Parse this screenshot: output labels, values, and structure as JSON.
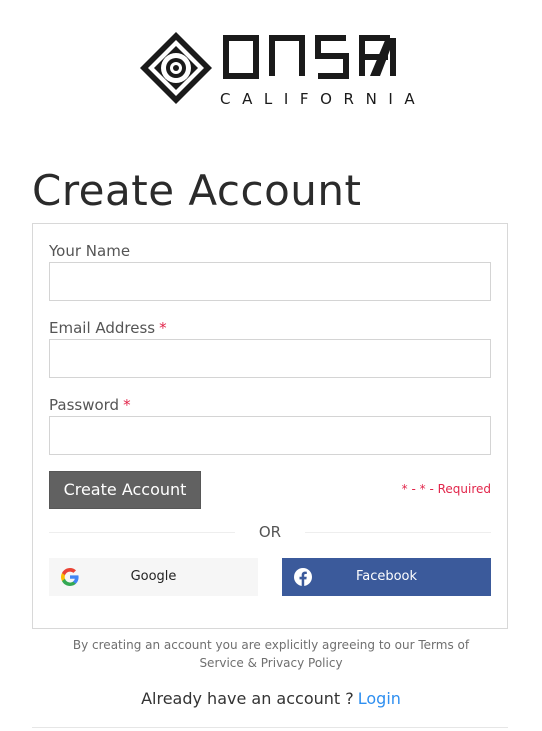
{
  "brand": {
    "subtitle": "CALIFORNIA",
    "colors": {
      "ink": "#1a1a1a"
    }
  },
  "page": {
    "title": "Create Account"
  },
  "form": {
    "fields": [
      {
        "label": "Your Name",
        "required": false,
        "value": "",
        "placeholder": ""
      },
      {
        "label": "Email Address",
        "required": true,
        "value": "",
        "placeholder": ""
      },
      {
        "label": "Password",
        "required": true,
        "value": "",
        "placeholder": ""
      }
    ],
    "required_mark": "*",
    "submit_label": "Create Account",
    "required_note": "* - * - Required",
    "or_label": "OR"
  },
  "social": {
    "google_label": "Google",
    "facebook_label": "Facebook",
    "icons": {
      "google": "google-icon",
      "facebook": "facebook-icon"
    },
    "colors": {
      "facebook_bg": "#3b5a9b",
      "google_bg": "#f6f6f6"
    }
  },
  "footer": {
    "terms_line1": "By creating an account you are explicitly agreeing to our Terms of",
    "terms_line2": "Service & Privacy Policy",
    "have_account": "Already have an account ?",
    "login_label": "Login"
  },
  "colors": {
    "required": "#e2264b",
    "button": "#616161",
    "link": "#2f8ff0"
  }
}
